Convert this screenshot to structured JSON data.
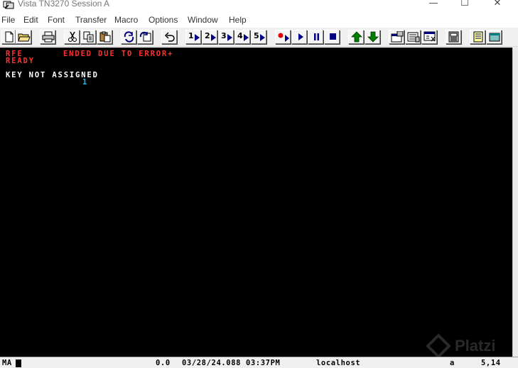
{
  "window": {
    "title": "Vista TN3270 Session A",
    "minimize_glyph": "—",
    "maximize_glyph": "☐",
    "close_glyph": "✕"
  },
  "menu": [
    "File",
    "Edit",
    "Font",
    "Transfer",
    "Macro",
    "Options",
    "Window",
    "Help"
  ],
  "toolbar": {
    "icons": [
      "new-doc-icon",
      "open-folder-icon",
      "print-icon",
      "cut-icon",
      "copy-icon",
      "paste-icon",
      "refresh-icon",
      "reconnect-icon",
      "undo-icon",
      "macro-1-icon",
      "macro-2-icon",
      "macro-3-icon",
      "macro-4-icon",
      "macro-5-icon",
      "record-icon",
      "play-icon",
      "pause-icon",
      "stop-icon",
      "upload-icon",
      "download-icon",
      "settings-1-icon",
      "settings-2-icon",
      "settings-3-icon",
      "keyboard-icon",
      "notes-icon",
      "window-icon"
    ],
    "macro_labels": [
      "1",
      "2",
      "3",
      "4",
      "5"
    ],
    "colors": {
      "record": "#e00000",
      "play": "#000080",
      "arrow": "#008000"
    }
  },
  "terminal": {
    "line1_left": "RFE",
    "line1_right": "ENDED DUE TO ERROR+",
    "line2": "READY",
    "line3": "KEY NOT ASSIGNED",
    "line4": "1",
    "colors": {
      "background": "#000000",
      "red": "#ff3030",
      "white": "#ffffff",
      "cyan": "#00c8ff"
    }
  },
  "watermark": {
    "text": "Platzi"
  },
  "status": {
    "indicator": "MA",
    "timing": "0.0",
    "datetime": "03/28/24.088 03:37PM",
    "host": "localhost",
    "mode": "a",
    "cursor_pos": "5,14"
  }
}
